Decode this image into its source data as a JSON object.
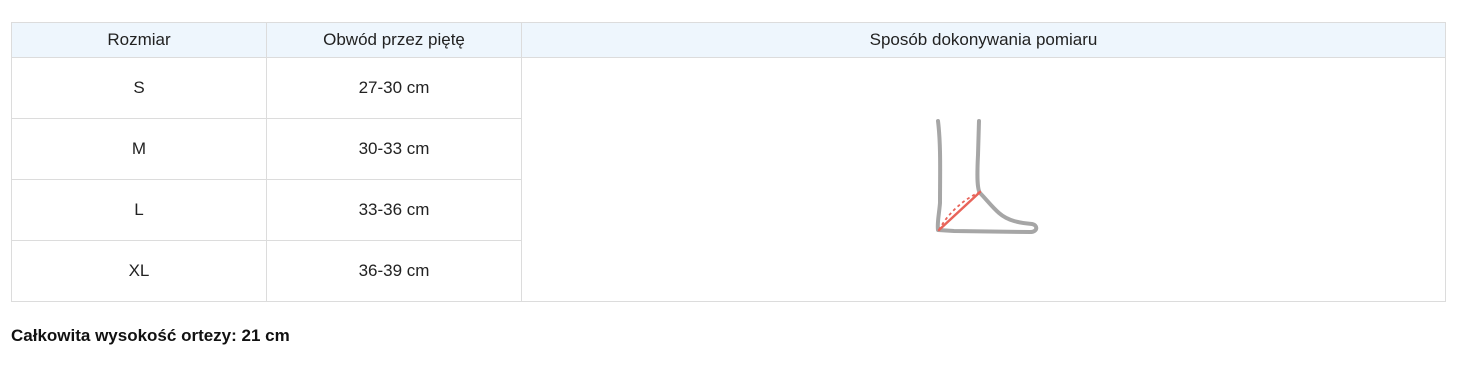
{
  "table": {
    "headers": {
      "size": "Rozmiar",
      "circumference": "Obwód przez piętę",
      "method": "Sposób dokonywania pomiaru"
    },
    "rows": [
      {
        "size": "S",
        "circumference": "27-30 cm"
      },
      {
        "size": "M",
        "circumference": "30-33 cm"
      },
      {
        "size": "L",
        "circumference": "33-36 cm"
      },
      {
        "size": "XL",
        "circumference": "36-39 cm"
      }
    ],
    "header_background": "#eef6fd",
    "border_color": "#dcdcdc"
  },
  "illustration": {
    "icon": "foot-measurement-illustration",
    "outline_color": "#a6a6a6",
    "measure_line_color": "#e8645a"
  },
  "note": "Całkowita wysokość ortezy: 21 cm"
}
